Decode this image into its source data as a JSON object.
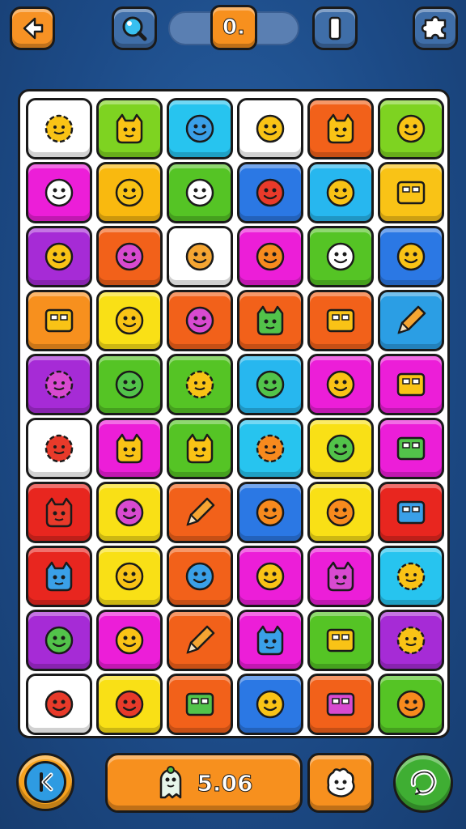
{
  "header": {
    "score_value": "0.",
    "icons": {
      "back": "arrow-left-icon",
      "hint": "magnifier-icon",
      "pause": "pause-icon",
      "puzzle": "puzzle-piece-icon"
    }
  },
  "footer": {
    "timer_value": "5.06",
    "icons": {
      "rewind": "rewind-icon",
      "timer": "ghost-mascot-icon",
      "helper": "ghost-hand-icon",
      "refresh": "refresh-icon"
    }
  },
  "colors": {
    "background": "#1f4e8c",
    "accent_orange": "#f7901e",
    "button_blue": "#3f6ea8",
    "refresh_green": "#3fae33"
  },
  "board": {
    "columns": 6,
    "rows": 10,
    "tiles": [
      {
        "color": "#ffffff",
        "icon": "sun-face-icon"
      },
      {
        "color": "#7ed321",
        "icon": "robot-figure-icon"
      },
      {
        "color": "#27c4ef",
        "icon": "blue-blob-icon"
      },
      {
        "color": "#ffffff",
        "icon": "egg-nest-icon"
      },
      {
        "color": "#f2611a",
        "icon": "cat-face-icon"
      },
      {
        "color": "#7ed321",
        "icon": "smiley-icon"
      },
      {
        "color": "#ec1ed8",
        "icon": "white-cloud-face-icon"
      },
      {
        "color": "#f9b90f",
        "icon": "lion-face-icon"
      },
      {
        "color": "#55c425",
        "icon": "cone-shell-icon"
      },
      {
        "color": "#2b78e4",
        "icon": "red-gem-icon"
      },
      {
        "color": "#27b7ef",
        "icon": "radish-icon"
      },
      {
        "color": "#f9c316",
        "icon": "battery-icon"
      },
      {
        "color": "#a62bd6",
        "icon": "smiley-icon"
      },
      {
        "color": "#f2611a",
        "icon": "pink-pig-icon"
      },
      {
        "color": "#ffffff",
        "icon": "log-icon"
      },
      {
        "color": "#ec1ed8",
        "icon": "pineapple-face-icon"
      },
      {
        "color": "#55c425",
        "icon": "snowman-icon"
      },
      {
        "color": "#2b78e4",
        "icon": "smiley-icon"
      },
      {
        "color": "#f7901e",
        "icon": "frame-icon"
      },
      {
        "color": "#f9e016",
        "icon": "lantern-icon"
      },
      {
        "color": "#f2611a",
        "icon": "pink-face-icon"
      },
      {
        "color": "#f2611a",
        "icon": "green-dino-icon"
      },
      {
        "color": "#f2611a",
        "icon": "usb-stick-icon"
      },
      {
        "color": "#2b9ee4",
        "icon": "pencil-icon"
      },
      {
        "color": "#a62bd6",
        "icon": "purple-virus-icon"
      },
      {
        "color": "#55c425",
        "icon": "green-face-icon"
      },
      {
        "color": "#55c425",
        "icon": "star-face-icon"
      },
      {
        "color": "#27b7ef",
        "icon": "green-ball-icon"
      },
      {
        "color": "#ec1ed8",
        "icon": "yellow-oval-icon"
      },
      {
        "color": "#ec1ed8",
        "icon": "tablet-icon"
      },
      {
        "color": "#ffffff",
        "icon": "red-virus-icon"
      },
      {
        "color": "#ec1ed8",
        "icon": "leaf-bird-icon"
      },
      {
        "color": "#55c425",
        "icon": "dragon-head-icon"
      },
      {
        "color": "#27c4ef",
        "icon": "orange-star-icon"
      },
      {
        "color": "#f9e016",
        "icon": "green-smiley-icon"
      },
      {
        "color": "#ec1ed8",
        "icon": "green-card-icon"
      },
      {
        "color": "#e8261f",
        "icon": "red-monster-icon"
      },
      {
        "color": "#f9e016",
        "icon": "purple-ball-icon"
      },
      {
        "color": "#f2611a",
        "icon": "pencil-icon"
      },
      {
        "color": "#2b78e4",
        "icon": "orange-face-icon"
      },
      {
        "color": "#f9e016",
        "icon": "orange-pot-face-icon"
      },
      {
        "color": "#e8261f",
        "icon": "blue-building-icon"
      },
      {
        "color": "#e8261f",
        "icon": "blue-robot-icon"
      },
      {
        "color": "#f9e016",
        "icon": "smiley-icon"
      },
      {
        "color": "#f2611a",
        "icon": "blue-blob-face-icon"
      },
      {
        "color": "#ec1ed8",
        "icon": "hamburger-icon"
      },
      {
        "color": "#ec1ed8",
        "icon": "pink-cat-icon"
      },
      {
        "color": "#27c4ef",
        "icon": "yellow-sun-face-icon"
      },
      {
        "color": "#a62bd6",
        "icon": "green-smiley-icon"
      },
      {
        "color": "#ec1ed8",
        "icon": "turtle-icon"
      },
      {
        "color": "#f2611a",
        "icon": "pencil-icon"
      },
      {
        "color": "#ec1ed8",
        "icon": "blue-cat-icon"
      },
      {
        "color": "#55c425",
        "icon": "keyboard-icon"
      },
      {
        "color": "#a62bd6",
        "icon": "yellow-flower-face-icon"
      },
      {
        "color": "#ffffff",
        "icon": "strawberry-icon"
      },
      {
        "color": "#f9e016",
        "icon": "red-pot-icon"
      },
      {
        "color": "#f2611a",
        "icon": "green-building-icon"
      },
      {
        "color": "#2b78e4",
        "icon": "tools-icon"
      },
      {
        "color": "#f2611a",
        "icon": "purple-house-icon"
      },
      {
        "color": "#55c425",
        "icon": "carrot-icon"
      }
    ]
  }
}
